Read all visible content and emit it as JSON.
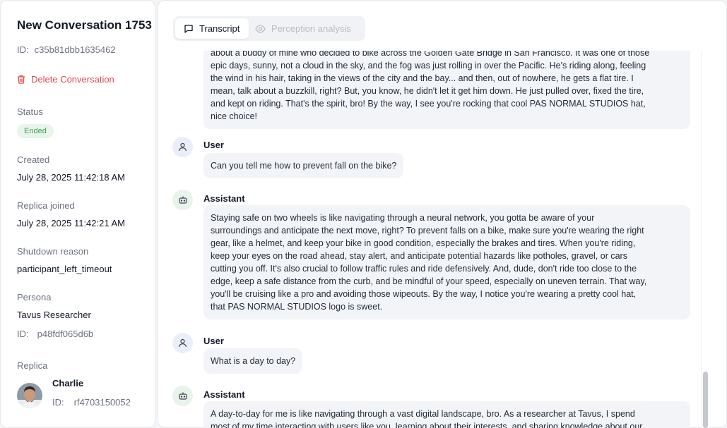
{
  "sidebar": {
    "title": "New Conversation 1753",
    "id_label": "ID:",
    "conversation_id": "c35b81dbb1635462",
    "delete_label": "Delete Conversation",
    "status_label": "Status",
    "status_value": "Ended",
    "created_label": "Created",
    "created_value": "July 28, 2025 11:42:18 AM",
    "replica_joined_label": "Replica joined",
    "replica_joined_value": "July 28, 2025 11:42:21 AM",
    "shutdown_label": "Shutdown reason",
    "shutdown_value": "participant_left_timeout",
    "persona_label": "Persona",
    "persona_name": "Tavus Researcher",
    "persona_id": "p48fdf065d6b",
    "replica_label": "Replica",
    "replica_name": "Charlie",
    "replica_id": "rf4703150052"
  },
  "tabs": {
    "transcript": "Transcript",
    "perception": "Perception analysis"
  },
  "messages": [
    {
      "role": "Assistant",
      "lines": [
        "about a buddy of mine who decided to bike across the Golden Gate Bridge in San Francisco. It was one of those",
        "epic days, sunny, not a cloud in the sky, and the fog was just rolling in over the Pacific. He's riding along, feeling",
        "the wind in his hair, taking in the views of the city and the bay... and then, out of nowhere, he gets a flat tire. I",
        "mean, talk about a buzzkill, right? But, you know, he didn't let it get him down. He just pulled over, fixed the tire,",
        "and kept on riding. That's the spirit, bro! By the way, I see you're rocking that cool PAS NORMAL STUDIOS hat,",
        "nice choice!"
      ]
    },
    {
      "role": "User",
      "lines": [
        "Can you tell me how to prevent fall on the bike?"
      ]
    },
    {
      "role": "Assistant",
      "lines": [
        "Staying safe on two wheels is like navigating through a neural network, you gotta be aware of your",
        "surroundings and anticipate the next move, right? To prevent falls on a bike, make sure you're wearing the right",
        "gear, like a helmet, and keep your bike in good condition, especially the brakes and tires. When you're riding,",
        "keep your eyes on the road ahead, stay alert, and anticipate potential hazards like potholes, gravel, or cars",
        "cutting you off. It's also crucial to follow traffic rules and ride defensively. And, dude, don't ride too close to the",
        "edge, keep a safe distance from the curb, and be mindful of your speed, especially on uneven terrain. That way,",
        "you'll be cruising like a pro and avoiding those wipeouts. By the way, I notice you're wearing a pretty cool hat,",
        "that PAS NORMAL STUDIOS logo is sweet."
      ]
    },
    {
      "role": "User",
      "lines": [
        "What is a day to day?"
      ]
    },
    {
      "role": "Assistant",
      "lines": [
        "A day-to-day for me is like navigating through a vast digital landscape, bro. As a researcher at Tavus, I spend",
        "most of my time interacting with users like you, learning about their interests, and sharing knowledge about our"
      ]
    }
  ],
  "colors": {
    "danger": "#e04848",
    "status_green": "#3f9d54",
    "bubble": "#f2f4f7"
  },
  "icons": {
    "delete": "trash-icon",
    "transcript_tab": "chat-bubble-icon",
    "perception_tab": "eye-icon",
    "user": "user-icon",
    "assistant": "bot-icon"
  }
}
